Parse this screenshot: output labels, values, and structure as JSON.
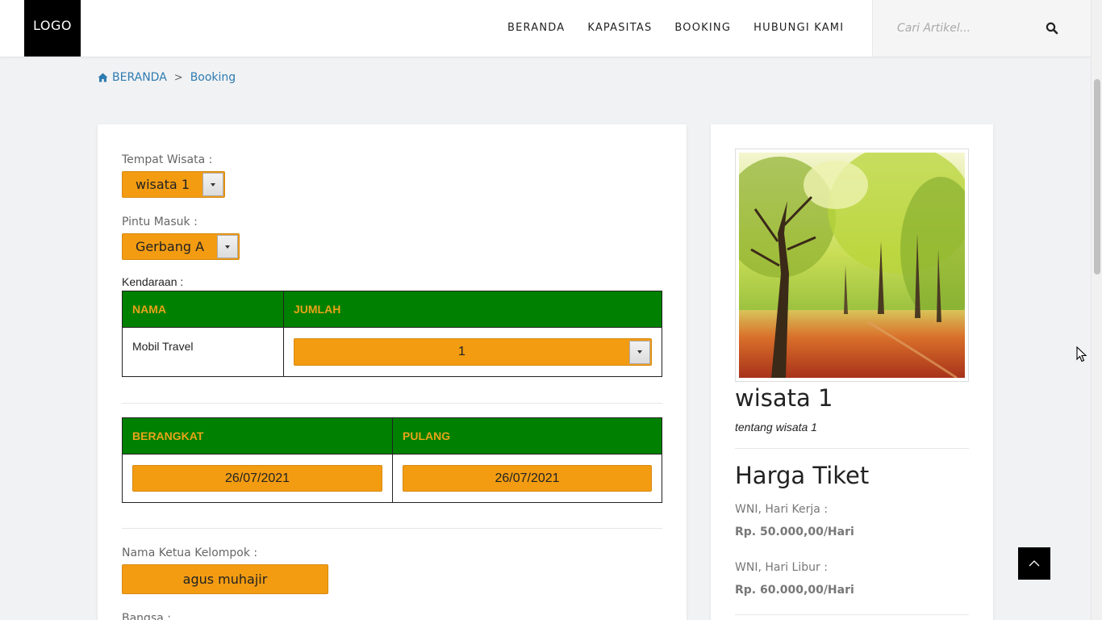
{
  "header": {
    "logo": "LOGO",
    "nav": [
      "BERANDA",
      "KAPASITAS",
      "BOOKING",
      "HUBUNGI KAMI"
    ],
    "search_placeholder": "Cari Artikel..."
  },
  "breadcrumb": {
    "home": "BERANDA",
    "separator": ">",
    "current": "Booking"
  },
  "form": {
    "tempat_label": "Tempat Wisata :",
    "tempat_value": "wisata 1",
    "pintu_label": "Pintu Masuk :",
    "pintu_value": "Gerbang A",
    "kendaraan_label": "Kendaraan :",
    "kendaraan_table": {
      "headers": [
        "NAMA",
        "JUMLAH"
      ],
      "rows": [
        {
          "nama": "Mobil Travel",
          "jumlah": "1"
        }
      ]
    },
    "date_table": {
      "headers": [
        "BERANGKAT",
        "PULANG"
      ],
      "berangkat": "26/07/2021",
      "pulang": "26/07/2021"
    },
    "ketua_label": "Nama Ketua Kelompok :",
    "ketua_value": "agus muhajir",
    "bangsa_label": "Bangsa :"
  },
  "sidebar": {
    "title": "wisata 1",
    "description": "tentang wisata 1",
    "price_heading": "Harga Tiket",
    "prices": [
      {
        "label": "WNI, Hari Kerja :",
        "value": "Rp. 50.000,00/Hari"
      },
      {
        "label": "WNI, Hari Libur :",
        "value": "Rp. 60.000,00/Hari"
      }
    ]
  },
  "colors": {
    "accent": "#f39c12",
    "table_header": "#008000",
    "table_header_text": "#e8a317",
    "link": "#2e7bb0"
  }
}
